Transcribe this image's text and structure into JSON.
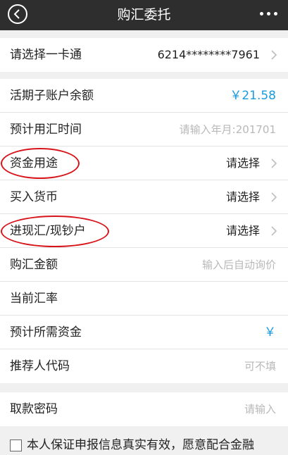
{
  "header": {
    "title": "购汇委托"
  },
  "rows": [
    {
      "label": "请选择一卡通",
      "value": "6214********7961"
    },
    {
      "label": "活期子账户余额",
      "value": "￥21.58"
    },
    {
      "label": "预计用汇时间",
      "placeholder": "请输入年月:201701"
    },
    {
      "label": "资金用途",
      "value": "请选择"
    },
    {
      "label": "买入货币",
      "value": "请选择"
    },
    {
      "label": "进现汇/现钞户",
      "value": "请选择"
    },
    {
      "label": "购汇金额",
      "placeholder": "输入后自动询价"
    },
    {
      "label": "当前汇率",
      "value": ""
    },
    {
      "label": "预计所需资金",
      "value": "￥"
    },
    {
      "label": "推荐人代码",
      "placeholder": "可不填"
    },
    {
      "label": "取款密码",
      "placeholder": "请输入"
    }
  ],
  "agreement": {
    "text": "本人保证申报信息真实有效，愿意配合金融"
  },
  "colors": {
    "header_bg": "#2e2e2e",
    "accent_blue": "#1a9ae0",
    "annotation_red": "#d8141b",
    "page_bg": "#f0f0f0"
  },
  "icons": [
    "back-icon",
    "more-icon",
    "chevron-right-icon",
    "checkbox"
  ]
}
